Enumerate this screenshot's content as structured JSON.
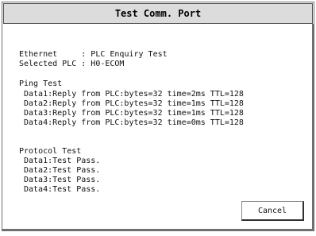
{
  "window": {
    "title": "Test Comm. Port"
  },
  "info": {
    "ethernet_line": "Ethernet     : PLC Enquiry Test",
    "selected_plc_line": "Selected PLC : H0-ECOM"
  },
  "ping_test": {
    "heading": "Ping Test",
    "lines": [
      "Data1:Reply from PLC:bytes=32 time=2ms TTL=128",
      "Data2:Reply from PLC:bytes=32 time=1ms TTL=128",
      "Data3:Reply from PLC:bytes=32 time=1ms TTL=128",
      "Data4:Reply from PLC:bytes=32 time=0ms TTL=128"
    ]
  },
  "protocol_test": {
    "heading": "Protocol Test",
    "lines": [
      "Data1:Test Pass.",
      "Data2:Test Pass.",
      "Data3:Test Pass.",
      "Data4:Test Pass."
    ]
  },
  "buttons": {
    "cancel_label": "Cancel"
  }
}
